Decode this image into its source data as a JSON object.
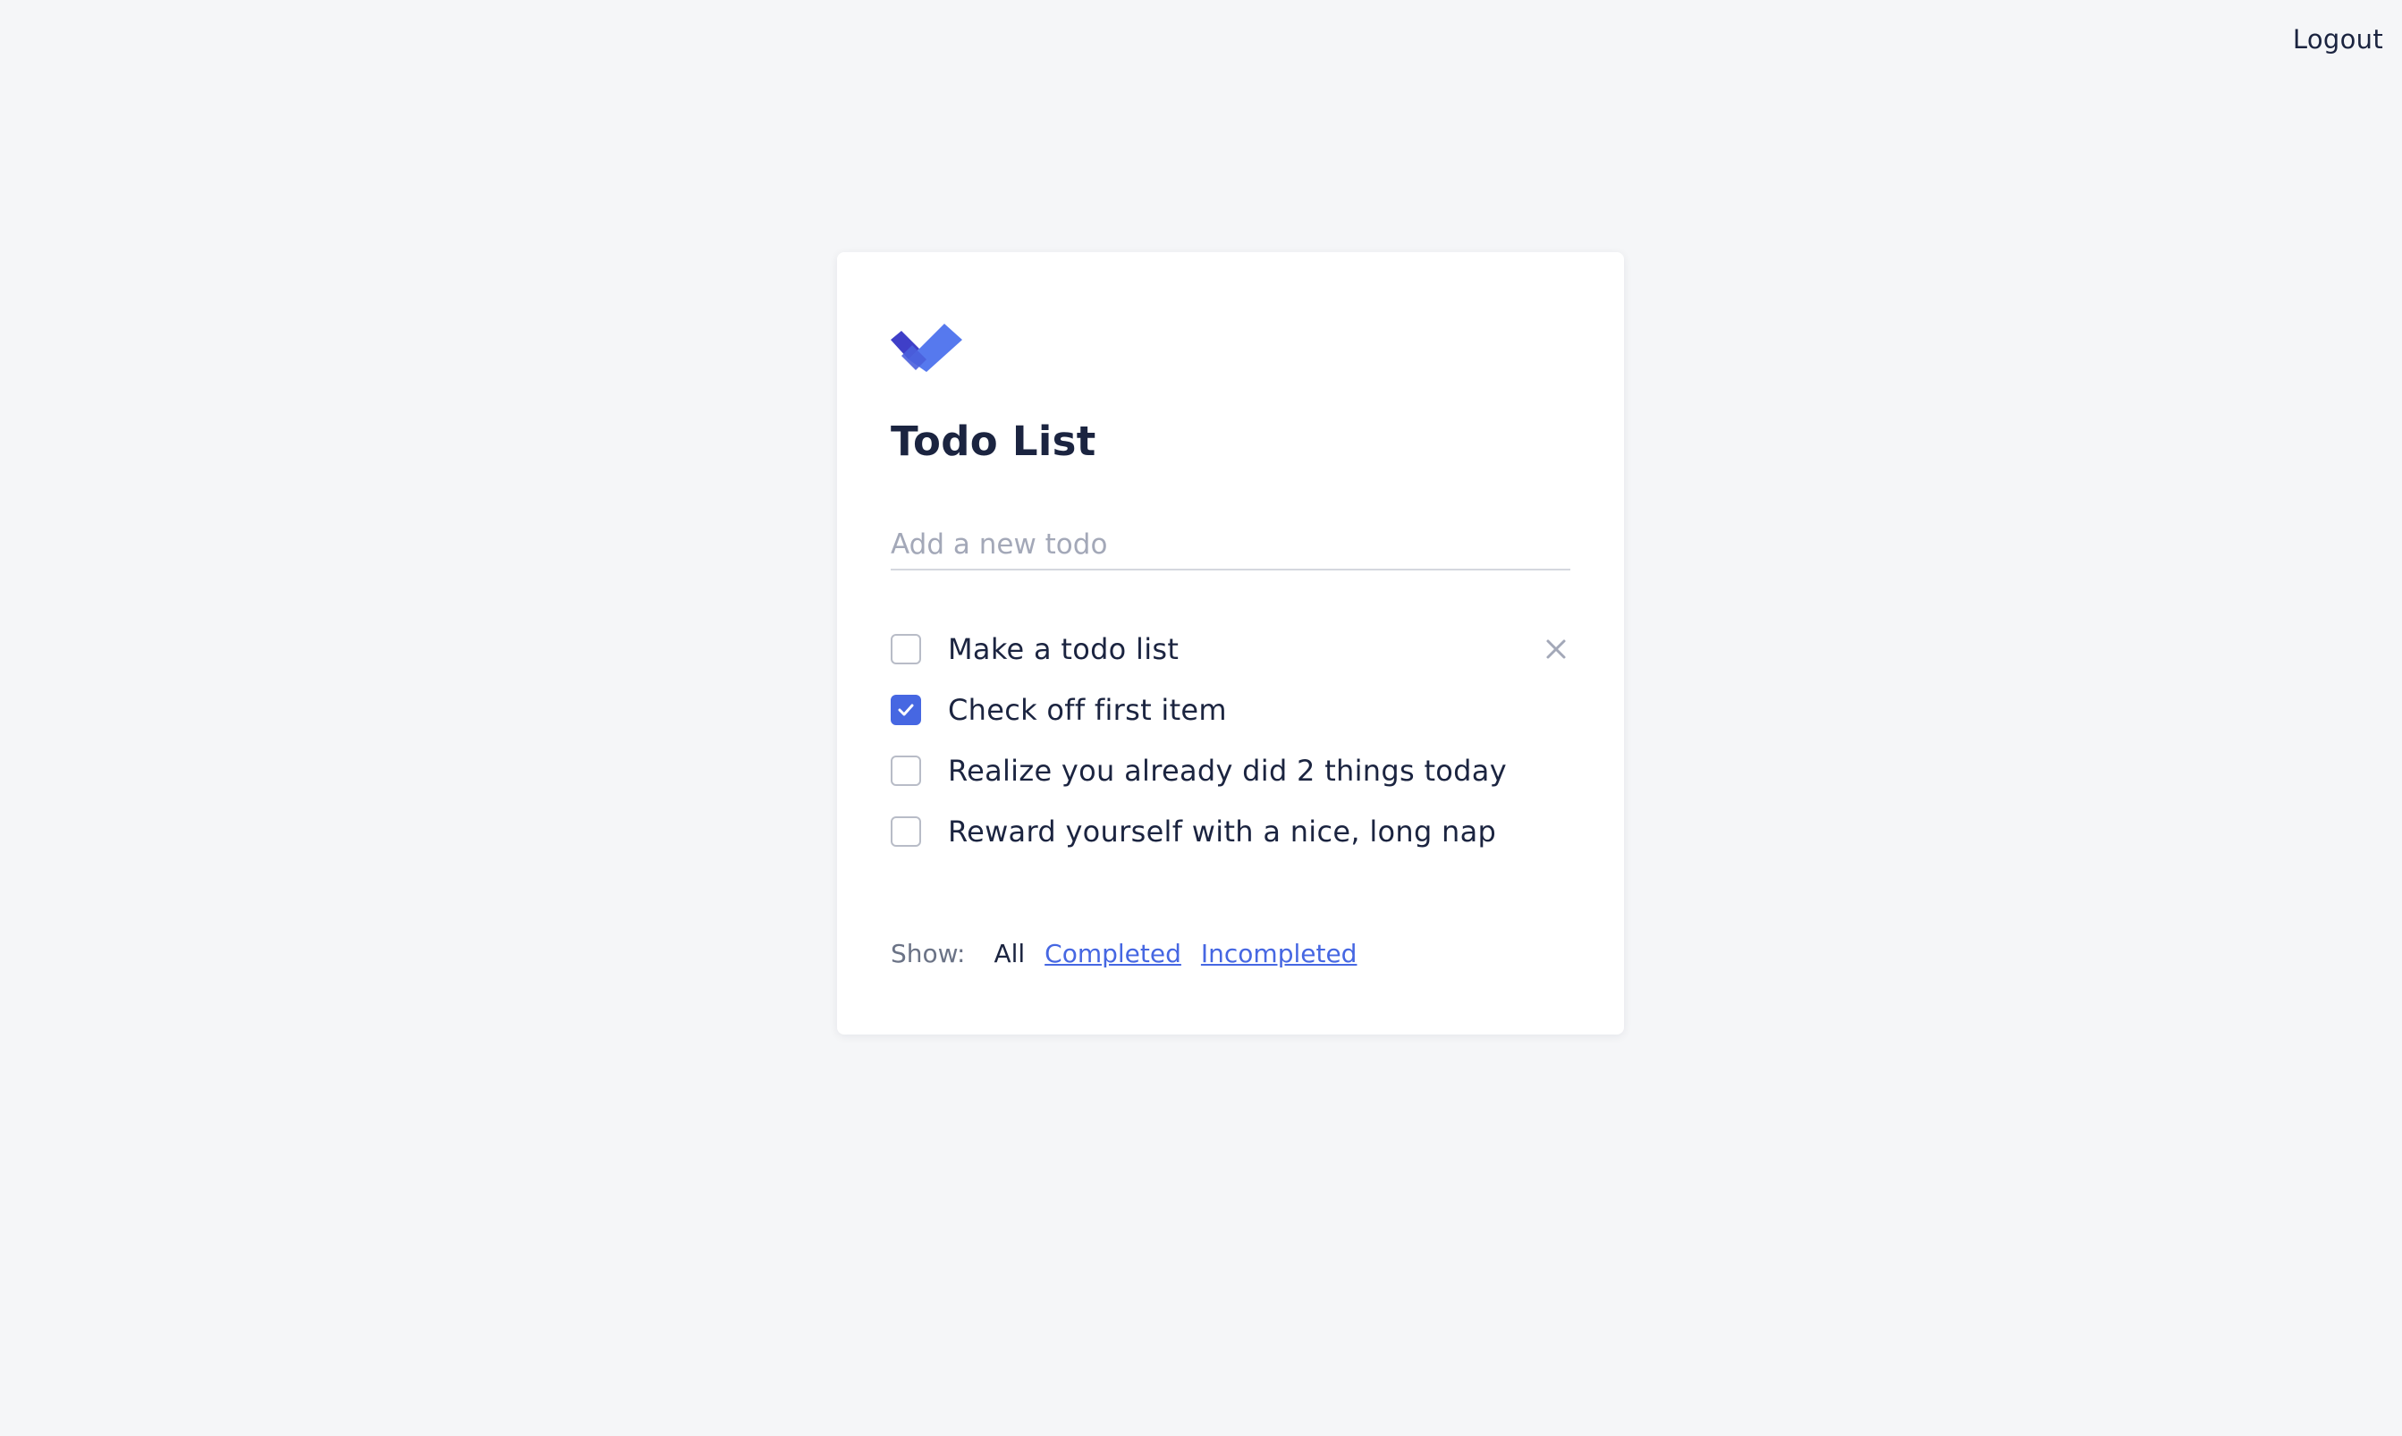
{
  "header": {
    "logout_label": "Logout"
  },
  "app": {
    "title": "Todo List",
    "logo_icon": "double-check-logo-icon",
    "colors": {
      "accent": "#4667e2",
      "background": "#f5f6f8",
      "text": "#1b2440"
    }
  },
  "new_todo": {
    "placeholder": "Add a new todo",
    "value": ""
  },
  "todos": [
    {
      "label": "Make a todo list",
      "completed": false
    },
    {
      "label": "Check off first item",
      "completed": true
    },
    {
      "label": "Realize you already did 2 things today",
      "completed": false
    },
    {
      "label": "Reward yourself with a nice, long nap",
      "completed": false
    }
  ],
  "filters": {
    "label": "Show:",
    "options": [
      "All",
      "Completed",
      "Incompleted"
    ],
    "selected": "All"
  }
}
